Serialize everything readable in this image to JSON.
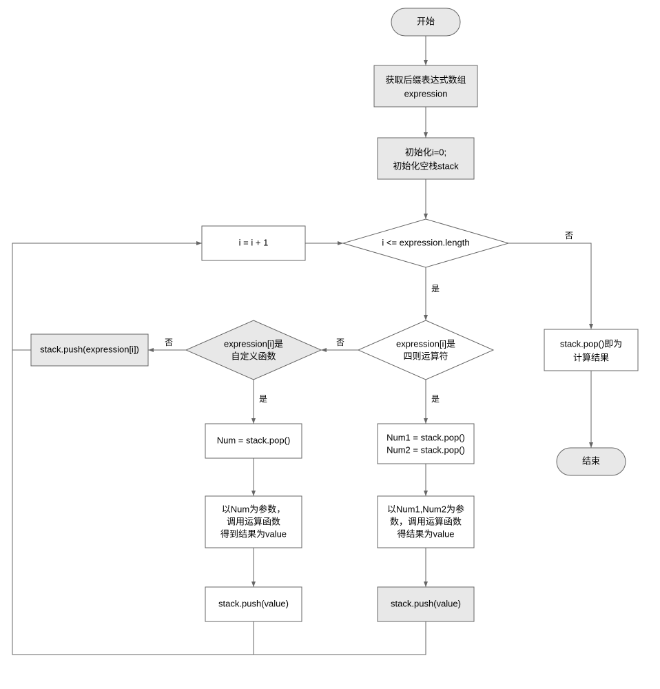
{
  "flowchart": {
    "nodes": {
      "start": {
        "label": "开始"
      },
      "get_expr": {
        "line1": "获取后缀表达式数组",
        "line2": "expression"
      },
      "init": {
        "line1": "初始化i=0;",
        "line2": "初始化空栈stack"
      },
      "increment": {
        "label": "i = i + 1"
      },
      "cond_len": {
        "label": "i <= expression.length"
      },
      "cond_arith": {
        "line1": "expression[i]是",
        "line2": "四则运算符"
      },
      "cond_func": {
        "line1": "expression[i]是",
        "line2": "自定义函数"
      },
      "push_expr": {
        "label": "stack.push(expression[i])"
      },
      "num_pop": {
        "label": "Num = stack.pop()"
      },
      "num_call": {
        "line1": "以Num为参数，",
        "line2": "调用运算函数",
        "line3": "得到结果为value"
      },
      "num_push": {
        "label": "stack.push(value)"
      },
      "num12_pop": {
        "line1": "Num1 = stack.pop()",
        "line2": "Num2 = stack.pop()"
      },
      "num12_call": {
        "line1": "以Num1,Num2为参",
        "line2": "数，调用运算函数",
        "line3": "得结果为value"
      },
      "num12_push": {
        "label": "stack.push(value)"
      },
      "result": {
        "line1": "stack.pop()即为",
        "line2": "计算结果"
      },
      "end": {
        "label": "结束"
      }
    },
    "edge_labels": {
      "yes": "是",
      "no": "否"
    }
  }
}
